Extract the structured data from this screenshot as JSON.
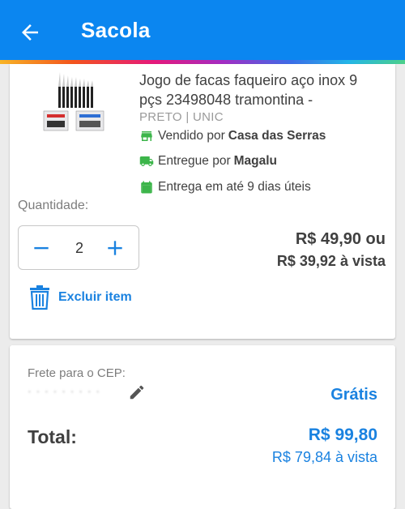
{
  "header": {
    "back_icon": "arrow-left-icon",
    "title": "Sacola",
    "color": "#0b86f0"
  },
  "product": {
    "title": "Jogo de facas faqueiro aço inox 9 pçs 23498048 tramontina -",
    "variant": "PRETO | UNIC",
    "sold_by_label": "Vendido por",
    "sold_by": "Casa das Serras",
    "delivered_by_label": "Entregue por",
    "delivered_by": "Magalu",
    "delivery_time": "Entrega em até 9 dias úteis",
    "icon_color": "#3cb54a",
    "quantity_label": "Quantidade:",
    "quantity": "2",
    "price": "R$ 49,90 ou",
    "price_cash": "R$ 39,92 à vista",
    "delete_label": "Excluir item"
  },
  "summary": {
    "frete_label": "Frete para o CEP:",
    "cep_value": "·  ·  ·  ·  ·  ·  ·  ·  ·",
    "frete_value": "Grátis",
    "total_label": "Total:",
    "total_value": "R$ 99,80",
    "total_cash": "R$ 79,84 à vista",
    "accent": "#1a82e0"
  }
}
